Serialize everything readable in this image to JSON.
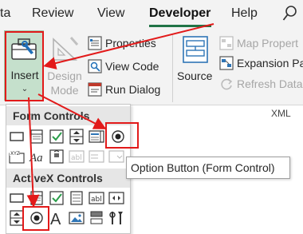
{
  "tabs": [
    {
      "label": "ta"
    },
    {
      "label": "Review"
    },
    {
      "label": "View"
    },
    {
      "label": "Developer"
    },
    {
      "label": "Help"
    }
  ],
  "ribbon": {
    "insert_label": "Insert",
    "design_mode_line1": "Design",
    "design_mode_line2": "Mode",
    "properties_label": "Properties",
    "view_code_label": "View Code",
    "run_dialog_label": "Run Dialog",
    "source_label": "Source",
    "map_properties_label": "Map Propert",
    "expansion_packs_label": "Expansion Pa",
    "refresh_data_label": "Refresh Data",
    "xml_group_label": "XML"
  },
  "gallery": {
    "form_controls_header": "Form Controls",
    "activex_controls_header": "ActiveX Controls"
  },
  "tooltip": {
    "text": "Option Button (Form Control)"
  },
  "colors": {
    "accent": "#217346",
    "highlight": "#e21a1a",
    "insert_bg": "#c5e0cc"
  }
}
